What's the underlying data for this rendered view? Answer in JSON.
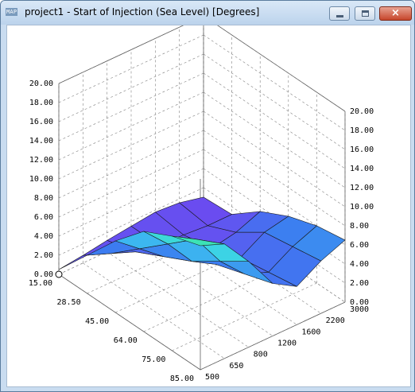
{
  "window": {
    "app_icon_text": "MAP",
    "title": "project1 - Start of Injection (Sea Level) [Degrees]",
    "buttons": {
      "close_glyph": "×"
    }
  },
  "colors": {
    "frame": "#c9dcf0",
    "titlebar_top": "#d9e8f7",
    "close_red": "#c6452b",
    "surface_low": "#7a3cf0",
    "surface_mid": "#3ca8f0",
    "surface_high": "#3cf08a",
    "grid": "#808080"
  },
  "chart_data": {
    "type": "surface3d",
    "title": "Start of Injection (Sea Level) [Degrees]",
    "z_ticks": [
      "0.00",
      "2.00",
      "4.00",
      "6.00",
      "8.00",
      "10.00",
      "12.00",
      "14.00",
      "16.00",
      "18.00",
      "20.00"
    ],
    "zlim": [
      0,
      20
    ],
    "x_ticks": [
      "15.00",
      "28.50",
      "45.00",
      "64.00",
      "75.00",
      "85.00"
    ],
    "y_ticks": [
      "500",
      "650",
      "800",
      "1200",
      "1600",
      "2200",
      "3000"
    ],
    "x_values": [
      15,
      28.5,
      45,
      64,
      75,
      85
    ],
    "y_values": [
      500,
      650,
      800,
      1200,
      1600,
      2200,
      3000
    ],
    "z": [
      [
        0.5,
        0.8,
        1.2,
        1.5,
        1.8,
        1.6,
        1.0
      ],
      [
        4.0,
        3.0,
        2.0,
        1.5,
        1.4,
        1.2,
        1.2
      ],
      [
        7.5,
        5.5,
        3.5,
        2.5,
        2.0,
        2.5,
        3.5
      ],
      [
        10.5,
        8.0,
        5.0,
        3.5,
        3.0,
        4.5,
        5.0
      ],
      [
        12.0,
        10.5,
        7.0,
        4.5,
        3.5,
        5.0,
        6.0
      ],
      [
        13.0,
        12.0,
        9.0,
        5.5,
        4.0,
        5.5,
        6.5
      ]
    ],
    "grid": true
  }
}
